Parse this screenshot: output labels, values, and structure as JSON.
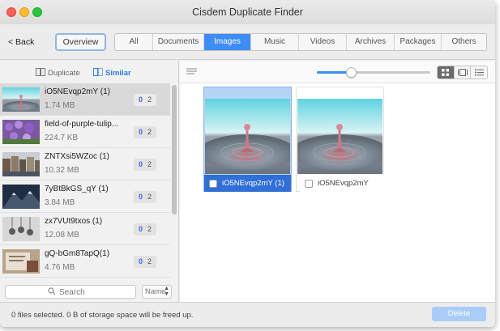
{
  "window": {
    "title": "Cisdem Duplicate Finder"
  },
  "toolbar": {
    "back_label": "< Back",
    "overview_label": "Overview",
    "tabs": [
      {
        "label": "All",
        "active": false
      },
      {
        "label": "Documents",
        "active": false
      },
      {
        "label": "Images",
        "active": true
      },
      {
        "label": "Music",
        "active": false
      },
      {
        "label": "Videos",
        "active": false
      },
      {
        "label": "Archives",
        "active": false
      },
      {
        "label": "Packages",
        "active": false
      },
      {
        "label": "Others",
        "active": false
      }
    ]
  },
  "sidebar": {
    "mode_duplicate": "Duplicate",
    "mode_similar": "Similar",
    "items": [
      {
        "name": "iO5NEvqp2mY (1)",
        "size": "1.74 MB",
        "selected_count": "0",
        "total_count": "2",
        "selected": true,
        "thumb": "splash"
      },
      {
        "name": "field-of-purple-tulip...",
        "size": "224.7 KB",
        "selected_count": "0",
        "total_count": "2",
        "selected": false,
        "thumb": "tulips"
      },
      {
        "name": "ZNTXsi5WZoc (1)",
        "size": "10.32 MB",
        "selected_count": "0",
        "total_count": "2",
        "selected": false,
        "thumb": "city"
      },
      {
        "name": "7yBtBkGS_qY (1)",
        "size": "3.84 MB",
        "selected_count": "0",
        "total_count": "2",
        "selected": false,
        "thumb": "mountain"
      },
      {
        "name": "zx7VUt9txos (1)",
        "size": "12.08 MB",
        "selected_count": "0",
        "total_count": "2",
        "selected": false,
        "thumb": "bulbs"
      },
      {
        "name": "gQ-bGm8TapQ(1)",
        "size": "4.76 MB",
        "selected_count": "0",
        "total_count": "2",
        "selected": false,
        "thumb": "books"
      }
    ],
    "search": {
      "placeholder": "Search",
      "value": ""
    },
    "sort": {
      "value": "Name"
    }
  },
  "main": {
    "zoom_level": 0.3,
    "view_modes": [
      "grid-view-icon",
      "filmstrip-view-icon",
      "list-view-icon"
    ],
    "active_view": "grid-view-icon",
    "cards": [
      {
        "name": "iO5NEvqp2mY (1)",
        "checked": false,
        "highlighted": true
      },
      {
        "name": "iO5NEvqp2mY",
        "checked": false,
        "highlighted": false
      }
    ]
  },
  "status": {
    "text": "0 files selected. 0 B of storage space will be freed up.",
    "delete_label": "Delete"
  },
  "colors": {
    "accent": "#3d8df5",
    "selected_card": "#2f6fd6",
    "delete_disabled": "#a9cdf7"
  }
}
